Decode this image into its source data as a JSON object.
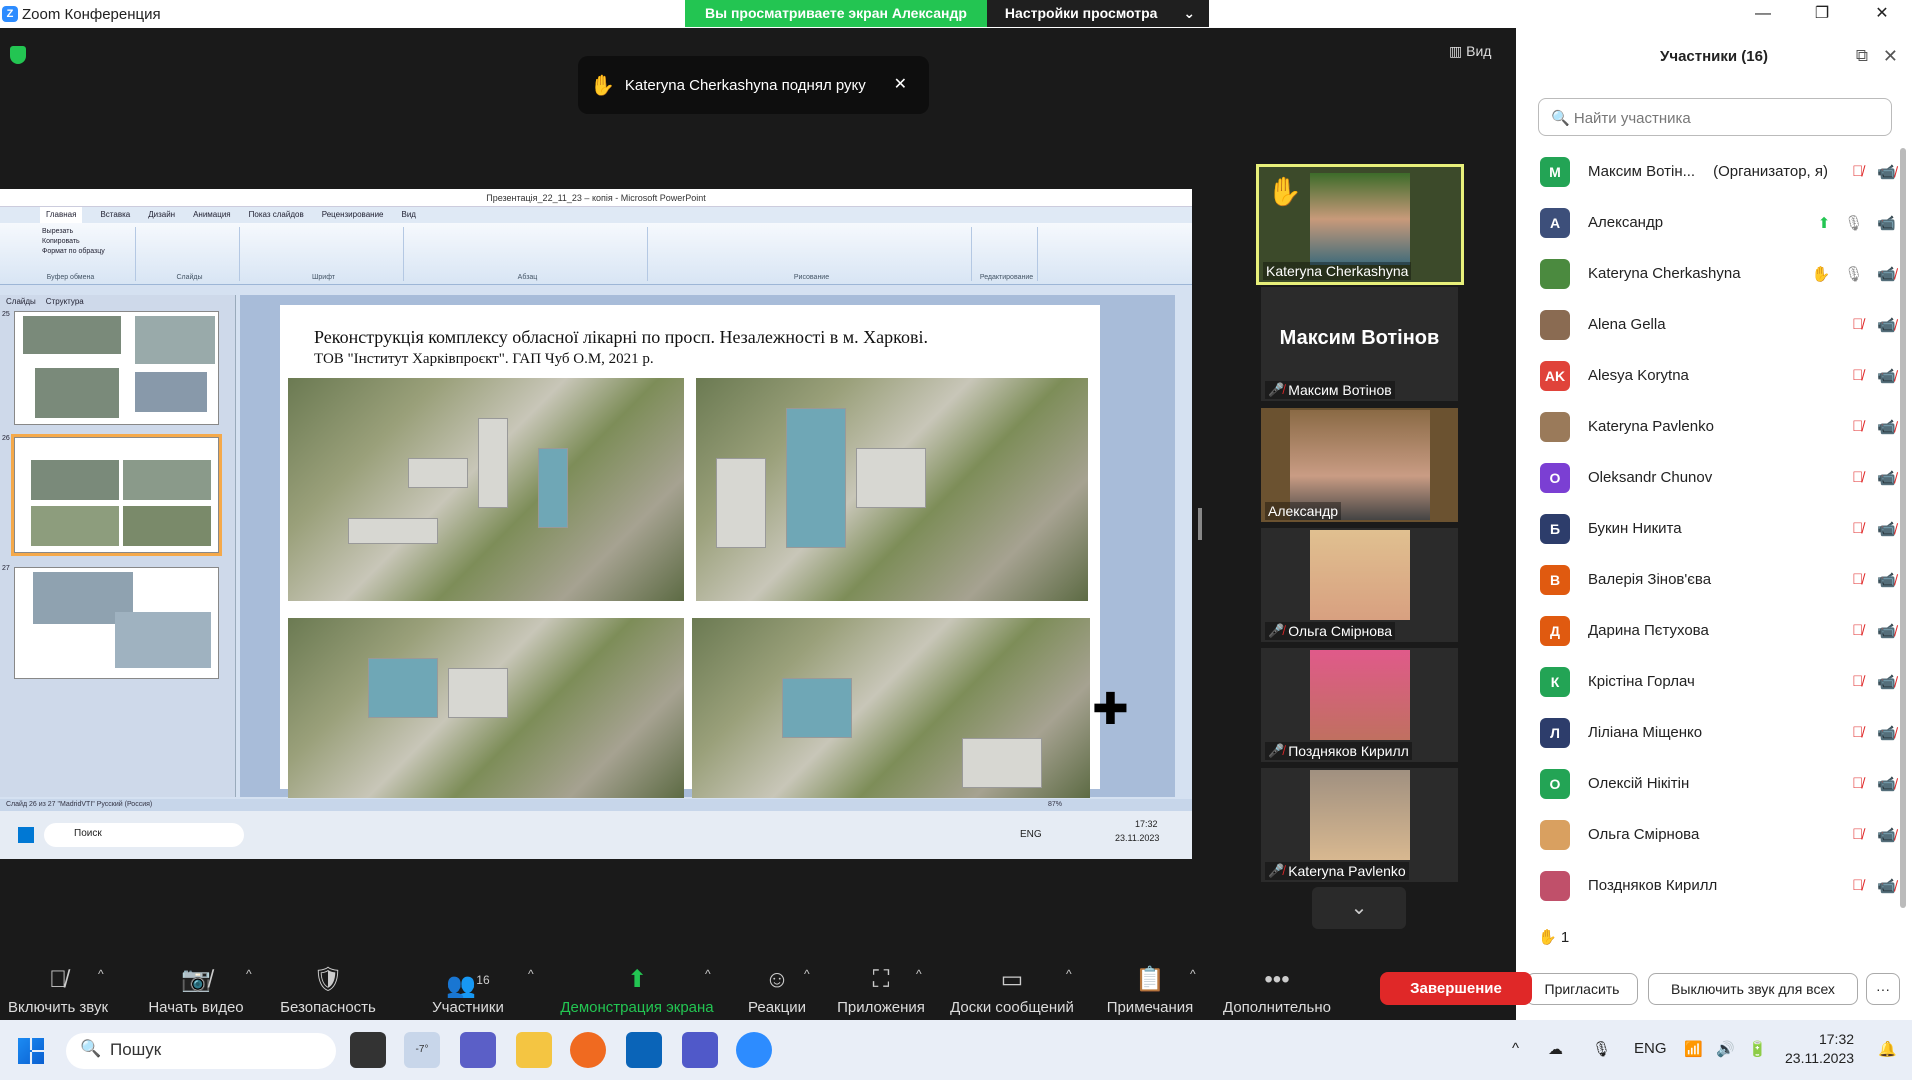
{
  "window": {
    "title": "Zoom Конференция"
  },
  "share_banner": {
    "viewing": "Вы просматриваете экран Александр",
    "options": "Настройки просмотра"
  },
  "view_button": "Вид",
  "toast": {
    "text": "Kateryna Cherkashyna поднял руку"
  },
  "ppt": {
    "title": "Презентація_22_11_23 – копія - Microsoft PowerPoint",
    "tabs": [
      "Главная",
      "Вставка",
      "Дизайн",
      "Анимация",
      "Показ слайдов",
      "Рецензирование",
      "Вид"
    ],
    "ribbon_groups": [
      "Буфер обмена",
      "Слайды",
      "Шрифт",
      "Абзац",
      "Рисование",
      "Редактирование"
    ],
    "clipboard": [
      "Вырезать",
      "Копировать",
      "Формат по образцу"
    ],
    "pane_tabs": [
      "Слайды",
      "Структура"
    ],
    "slide_numbers": [
      "25",
      "26",
      "27"
    ],
    "slide_title": "Реконструкція комплексу обласної лікарні по просп. Незалежності в м. Харкові.",
    "slide_subtitle": "ТОВ \"Інститут Харківпроєкт\". ГАП Чуб О.М, 2021 р.",
    "status": "Слайд 26 из 27   \"MadridVTI\"   Русский (Россия)",
    "zoom": "87%",
    "inner_search": "Поиск",
    "inner_lang": "ENG",
    "inner_time": "17:32",
    "inner_date": "23.11.2023"
  },
  "gallery": [
    {
      "name": "Kateryna Cherkashyna",
      "hand": true
    },
    {
      "name": "Максим Вотінов",
      "big": "Максим Вотінов"
    },
    {
      "name": "Александр"
    },
    {
      "name": "Ольга Смірнова"
    },
    {
      "name": "Поздняков Кирилл"
    },
    {
      "name": "Kateryna Pavlenko"
    }
  ],
  "panel": {
    "title": "Участники (16)",
    "search_placeholder": "Найти участника",
    "participants": [
      {
        "initial": "М",
        "name": "Максим Вотін...",
        "role": "(Организатор, я)",
        "color": "#23a455"
      },
      {
        "initial": "А",
        "name": "Александр",
        "color": "#3d4f7a"
      },
      {
        "initial": "",
        "name": "Kateryna Cherkashyna",
        "color": "#4b8a3f"
      },
      {
        "initial": "",
        "name": "Alena Gella",
        "color": "#8a6b52"
      },
      {
        "initial": "AK",
        "name": "Alesya Korytna",
        "color": "#e0433a"
      },
      {
        "initial": "",
        "name": "Kateryna Pavlenko",
        "color": "#9a7a5a"
      },
      {
        "initial": "O",
        "name": "Oleksandr Chunov",
        "color": "#7b3fd3"
      },
      {
        "initial": "Б",
        "name": "Букин Никита",
        "color": "#2d3d6b"
      },
      {
        "initial": "В",
        "name": "Валерія Зінов'єва",
        "color": "#e05a10"
      },
      {
        "initial": "Д",
        "name": "Дарина Пєтухова",
        "color": "#e05a10"
      },
      {
        "initial": "К",
        "name": "Крістіна Горлач",
        "color": "#23a455"
      },
      {
        "initial": "Л",
        "name": "Ліліана Міщенко",
        "color": "#2d3d6b"
      },
      {
        "initial": "О",
        "name": "Олексій Нікітін",
        "color": "#23a455"
      },
      {
        "initial": "",
        "name": "Ольга Смірнова",
        "color": "#d9a060"
      },
      {
        "initial": "",
        "name": "Поздняков Кирилл",
        "color": "#c0506a"
      }
    ],
    "raised_count": "1",
    "invite": "Пригласить",
    "mute_all": "Выключить звук для всех",
    "more": "···"
  },
  "toolbar": {
    "mute": "Включить звук",
    "video": "Начать видео",
    "security": "Безопасность",
    "participants": "Участники",
    "participants_count": "16",
    "share": "Демонстрация экрана",
    "reactions": "Реакции",
    "apps": "Приложения",
    "whiteboards": "Доски сообщений",
    "notes": "Примечания",
    "more": "Дополнительно",
    "end": "Завершение"
  },
  "taskbar": {
    "search": "Пошук",
    "weather": "-7°",
    "lang": "ENG",
    "time": "17:32",
    "date": "23.11.2023"
  },
  "colors": {
    "zoom_green": "#23c552",
    "end_red": "#e02828",
    "zoom_blue": "#2d8cff"
  }
}
